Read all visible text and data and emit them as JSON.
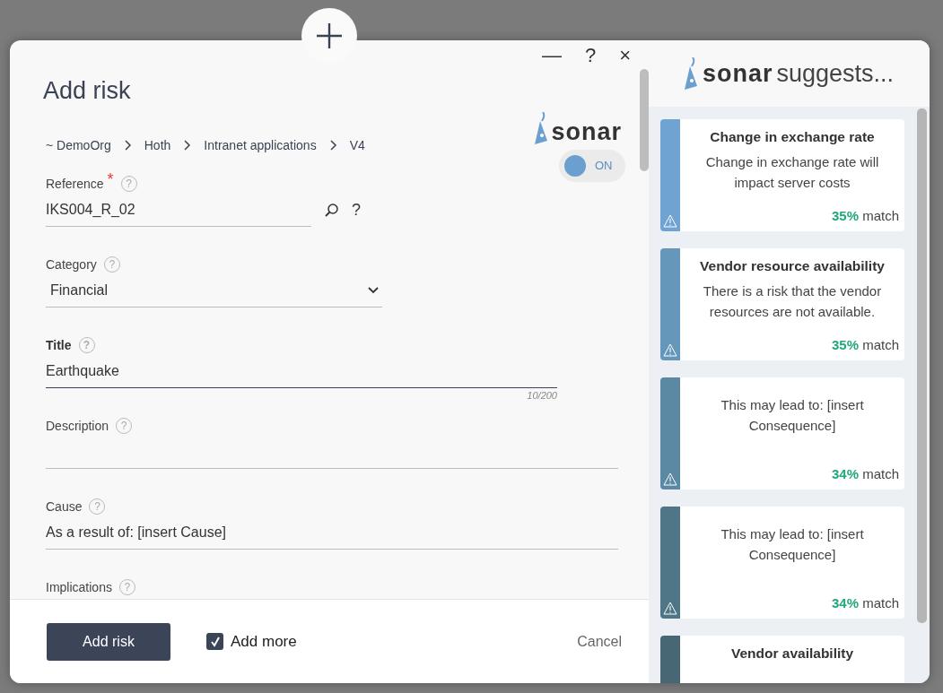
{
  "dialog": {
    "title": "Add risk",
    "window_buttons": [
      "—",
      "?",
      "×"
    ],
    "breadcrumb": [
      "~ DemoOrg",
      "Hoth",
      "Intranet applications",
      "V4"
    ],
    "sonar": {
      "logo": "sonar",
      "toggle_label": "ON"
    },
    "fields": [
      {
        "kind": "text",
        "label": "Reference",
        "required_mark": "*",
        "help": "?",
        "value": "IKS004_R_02",
        "lookup_help": "?"
      },
      {
        "kind": "select",
        "label": "Category",
        "help": "?",
        "value": "Financial"
      },
      {
        "kind": "text",
        "label": "Title",
        "help": "?",
        "value": "Earthquake",
        "counter": "10/200",
        "bold": true,
        "focused": true
      },
      {
        "kind": "text",
        "label": "Description",
        "help": "?"
      },
      {
        "kind": "text",
        "label": "Cause",
        "help": "?",
        "value": "As a result of: [insert Cause]"
      },
      {
        "kind": "label",
        "label": "Implications",
        "help": "?"
      }
    ],
    "footer": {
      "submit": "Add risk",
      "add_more": {
        "label": "Add more",
        "checked": true
      },
      "cancel": "Cancel"
    }
  },
  "suggestions": {
    "logo": "sonar",
    "heading": "suggests...",
    "cards": [
      {
        "title": "Change in exchange rate",
        "text": "Change in exchange rate will impact server costs",
        "percent": "35%",
        "match": "match",
        "color": "#6fa3d1"
      },
      {
        "title": "Vendor resource availability",
        "text": "There is a risk that the vendor resources are not available.",
        "percent": "35%",
        "match": "match",
        "color": "#6597bb"
      },
      {
        "text": "This may lead to: [insert Consequence]",
        "percent": "34%",
        "match": "match",
        "color": "#5b88a3"
      },
      {
        "text": "This may lead to: [insert Consequence]",
        "percent": "34%",
        "match": "match",
        "color": "#4f7686"
      },
      {
        "title": "Vendor availability",
        "color": "#486774"
      }
    ]
  }
}
